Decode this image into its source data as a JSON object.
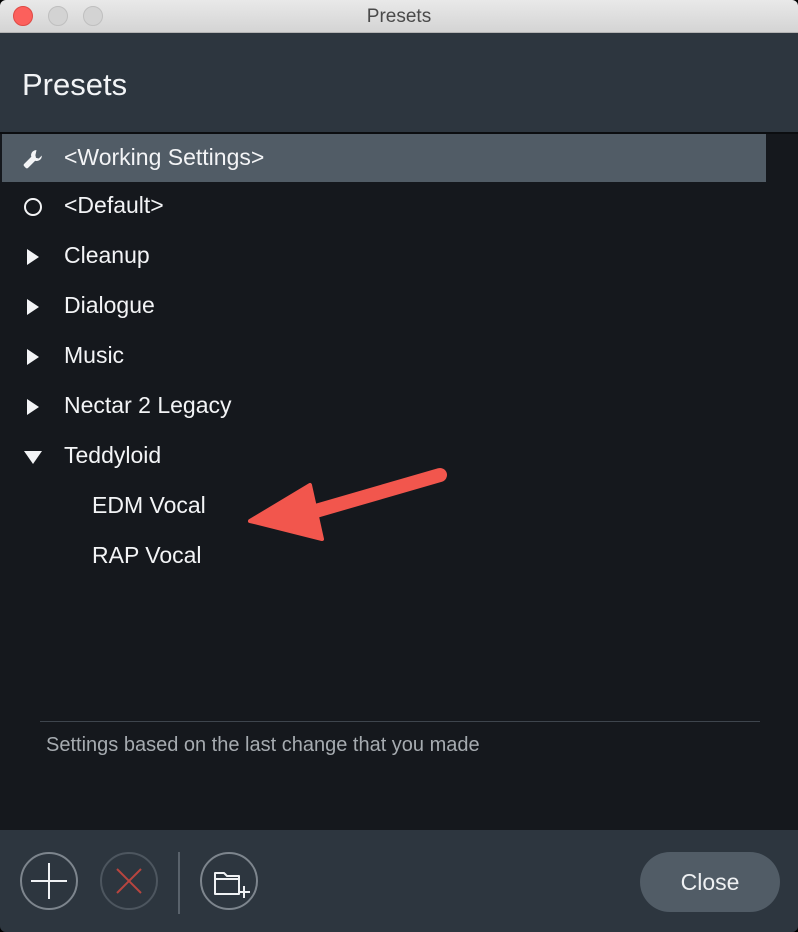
{
  "window": {
    "title": "Presets"
  },
  "header": {
    "title": "Presets"
  },
  "presets": {
    "items": [
      {
        "label": "<Working Settings>",
        "icon": "wrench-icon",
        "selected": true
      },
      {
        "label": "<Default>",
        "icon": "circle-icon"
      },
      {
        "label": "Cleanup",
        "icon": "triangle-right-icon"
      },
      {
        "label": "Dialogue",
        "icon": "triangle-right-icon"
      },
      {
        "label": "Music",
        "icon": "triangle-right-icon"
      },
      {
        "label": "Nectar 2 Legacy",
        "icon": "triangle-right-icon"
      },
      {
        "label": "Teddyloid",
        "icon": "triangle-down-icon",
        "expanded": true
      },
      {
        "label": "EDM Vocal",
        "parent": "Teddyloid"
      },
      {
        "label": "RAP Vocal",
        "parent": "Teddyloid"
      }
    ]
  },
  "description": {
    "text": "Settings based on the last change that you made"
  },
  "footer": {
    "add_icon": "plus-icon",
    "delete_icon": "x-icon",
    "new_folder_icon": "new-folder-icon",
    "close_label": "Close"
  },
  "colors": {
    "header_bg": "#2d363f",
    "list_bg": "#15181d",
    "selected_bg": "#515c66",
    "annotation_arrow": "#f2564d"
  }
}
